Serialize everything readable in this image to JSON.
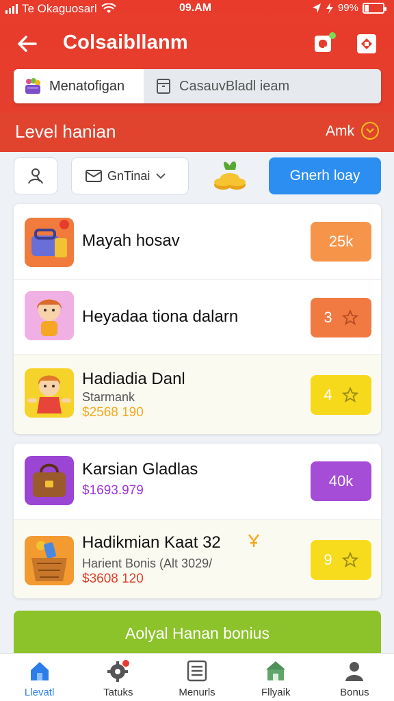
{
  "status_bar": {
    "carrier": "Te Okaguosarl",
    "time": "09.AM",
    "battery_percent": "99%"
  },
  "topbar": {
    "title": "Colsaibllanm"
  },
  "search": {
    "left_label": "Menatofigan",
    "right_label": "CasauvBladl ieam"
  },
  "level": {
    "title": "Level hanian",
    "right_label": "Amk"
  },
  "filters": {
    "sort_label": "GnTinai",
    "primary_button": "Gnerh loay"
  },
  "cards": [
    {
      "items": [
        {
          "title": "Mayah hosav",
          "subtitle": "",
          "price": "",
          "badge": "25k",
          "badge_color": "#f6954a",
          "star": false,
          "thumb_bg": "#f07b3c"
        },
        {
          "title": "Heyadaa tiona dalarn",
          "subtitle": "",
          "price": "",
          "badge": "3",
          "badge_color": "#f07a42",
          "star": true,
          "thumb_bg": "#ef8a5e"
        },
        {
          "title": "Hadiadia Danl",
          "subtitle": "Starmank",
          "price": "$2568 190",
          "price_color": "#f2a81d",
          "badge": "4",
          "badge_color": "#f7d91c",
          "star": true,
          "thumb_bg": "#f6d32a"
        }
      ]
    },
    {
      "items": [
        {
          "title": "Karsian Gladlas",
          "subtitle": "",
          "price": "$1693.979",
          "price_color": "#a133d6",
          "badge": "40k",
          "badge_color": "#a64dd8",
          "star": false,
          "thumb_bg": "#9b45d4"
        },
        {
          "title": "Hadikmian Kaat 32",
          "subtitle": "Harient Bonis (Alt 3029/",
          "price": "$3608 120",
          "price_color": "#d9402b",
          "badge": "9",
          "badge_color": "#f7dc1e",
          "star": true,
          "thumb_bg": "#f39a31"
        }
      ]
    }
  ],
  "bonus_button": "Aolyal Hanan bonius",
  "nav": [
    {
      "label": "Llevatl",
      "icon": "home-icon",
      "active": true
    },
    {
      "label": "Tatuks",
      "icon": "gear-icon",
      "active": false
    },
    {
      "label": "Menurls",
      "icon": "menu-list-icon",
      "active": false
    },
    {
      "label": "Fllyaik",
      "icon": "store-icon",
      "active": false
    },
    {
      "label": "Bonus",
      "icon": "user-icon",
      "active": false
    }
  ],
  "colors": {
    "header_red": "#e83b2c",
    "primary_blue": "#2b8ef0",
    "bonus_green": "#8cc22a",
    "nav_active": "#2b7de9"
  }
}
